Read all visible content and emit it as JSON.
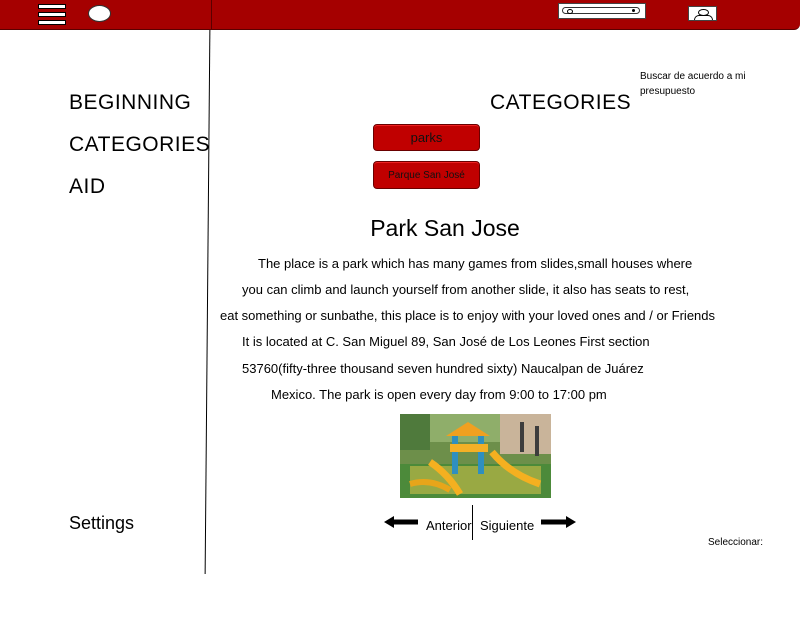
{
  "sidebar": {
    "items": [
      "BEGINNING",
      "CATEGORIES",
      "AID"
    ],
    "settings_label": "Settings"
  },
  "header": {
    "budget_search": "Buscar de acuerdo a mi presupuesto"
  },
  "main": {
    "section_title": "CATEGORIES",
    "category_button": "parks",
    "park_button": "Parque San José",
    "park_title": "Park San Jose",
    "description": [
      "The place is a park which has many games from slides,small houses where",
      "you can climb and launch yourself from another slide, it also has seats to rest,",
      "eat something or sunbathe, this place is to enjoy with your loved ones and / or Friends",
      "It is located at C. San Miguel 89, San José de Los Leones First section",
      "53760(fifty-three thousand seven hundred sixty) Naucalpan de Juárez",
      "Mexico. The park is open every day from 9:00 to 17:00 pm"
    ],
    "prev_label": "Anterior",
    "next_label": "Siguiente",
    "select_label": "Seleccionar:"
  },
  "icons": {
    "menu": "hamburger-icon",
    "logo": "oval-logo",
    "search": "search-icon",
    "user": "user-icon",
    "prev": "arrow-left-icon",
    "next": "arrow-right-icon"
  },
  "colors": {
    "brand": "#a50000",
    "button": "#c00000",
    "background": "#ffffff"
  }
}
